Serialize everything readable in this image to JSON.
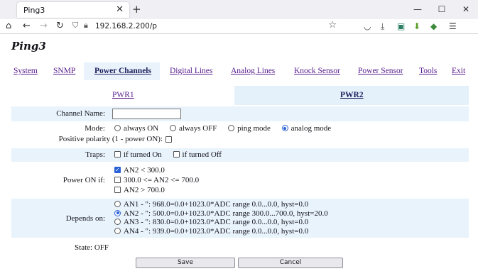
{
  "browser": {
    "tab_title": "Ping3",
    "tab_close": "✕",
    "new_tab": "+",
    "win_min": "—",
    "win_max": "☐",
    "win_close": "✕",
    "url": "192.168.2.200/p"
  },
  "page": {
    "title": "Ping3",
    "menu": [
      "System",
      "SNMP",
      "Power Channels",
      "Digital Lines",
      "Analog Lines",
      "Knock Sensor",
      "Power Sensor",
      "Tools",
      "Exit"
    ],
    "subtabs": [
      "PWR1",
      "PWR2"
    ],
    "channel_name": {
      "label": "Channel Name:",
      "value": ""
    },
    "mode": {
      "label": "Mode:",
      "options": [
        "always ON",
        "always OFF",
        "ping mode",
        "analog mode"
      ],
      "selected": "analog mode"
    },
    "polarity": {
      "label": "Positive polarity (1 - power ON):",
      "checked": false
    },
    "traps": {
      "label": "Traps:",
      "options": [
        "if turned On",
        "if turned Off"
      ]
    },
    "power_on_if": {
      "label": "Power ON if:",
      "options": [
        "AN2 < 300.0",
        "300.0 <= AN2 <= 700.0",
        "AN2 > 700.0"
      ],
      "checked": [
        true,
        false,
        false
      ]
    },
    "depends_on": {
      "label": "Depends on:",
      "options": [
        "AN1 - \": 968.0=0.0+1023.0*ADC range 0.0...0.0, hyst=0.0",
        "AN2 - \": 500.0=0.0+1023.0*ADC range 300.0...700.0, hyst=20.0",
        "AN3 - \": 830.0=0.0+1023.0*ADC range 0.0...0.0, hyst=0.0",
        "AN4 - \": 939.0=0.0+1023.0*ADC range 0.0...0.0, hyst=0.0"
      ],
      "selected": 1
    },
    "state": "State: OFF",
    "save_label": "Save",
    "cancel_label": "Cancel"
  },
  "colors": {
    "accent": "#2a61d6",
    "link": "#551a8b",
    "row_shade": "#e9f3fc"
  }
}
